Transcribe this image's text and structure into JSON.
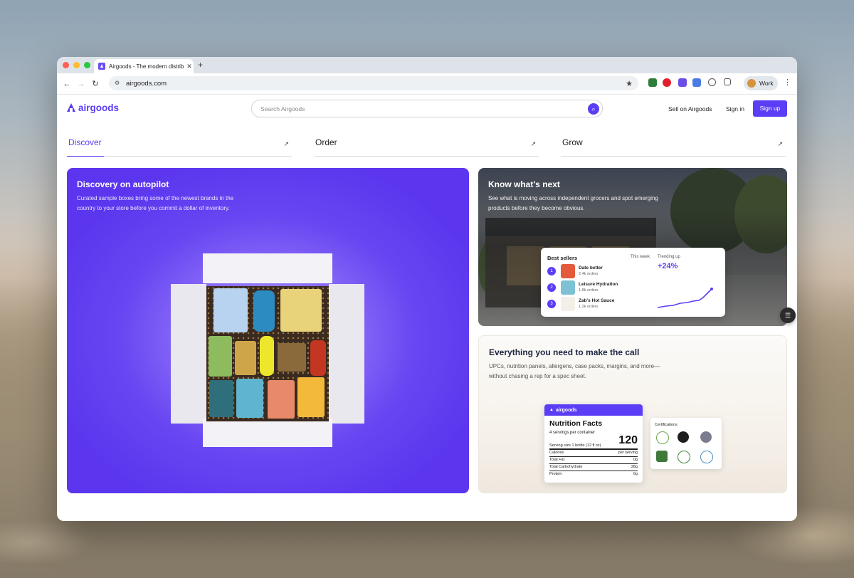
{
  "browser": {
    "tab_title": "Airgoods - The modern distrib",
    "url": "airgoods.com",
    "profile_label": "Work"
  },
  "site": {
    "logo_text": "airgoods",
    "search_placeholder": "Search Airgoods",
    "sell_link": "Sell on Airgoods",
    "signin_link": "Sign in",
    "signup_button": "Sign up",
    "nav_tabs": [
      {
        "label": "Discover",
        "active": true
      },
      {
        "label": "Order",
        "active": false
      },
      {
        "label": "Grow",
        "active": false
      }
    ]
  },
  "discover_card": {
    "title": "Discovery on autopilot",
    "desc_line1": "Curated sample boxes bring some of the newest brands in the",
    "desc_line2": "country to your store before you commit a dollar of inventory."
  },
  "trends_card": {
    "title": "Know what's next",
    "desc_line1": "See what is moving across independent grocers and spot emerging",
    "desc_line2": "products before they become obvious.",
    "widget": {
      "header": "Best sellers",
      "this_week": "This week",
      "trending_label": "Trending up",
      "trending_value": "+24%",
      "items": [
        {
          "rank": "1",
          "name": "Date better",
          "orders": "2.4k orders"
        },
        {
          "rank": "2",
          "name": "Leisure Hydration",
          "orders": "1.8k orders"
        },
        {
          "rank": "3",
          "name": "Zab's Hot Sauce",
          "orders": "1.2k orders"
        }
      ]
    }
  },
  "info_card": {
    "title": "Everything you need to make the call",
    "desc_line1": "UPCs, nutrition panels, allergens, case packs, margins, and more—",
    "desc_line2": "without chasing a rep for a spec sheet.",
    "nutrition": {
      "brand": "airgoods",
      "title": "Nutrition Facts",
      "servings": "4 servings per container",
      "calories_big": "120",
      "serving_size": "Serving size 1 bottle (12 fl oz)",
      "rows": [
        {
          "label": "Calories",
          "value": "per serving"
        },
        {
          "label": "Total Fat",
          "value": "0g"
        },
        {
          "label": "Total Carbohydrate",
          "value": "28g"
        },
        {
          "label": "Protein",
          "value": "0g"
        }
      ]
    },
    "certifications_label": "Certifications"
  },
  "colors": {
    "brand": "#5b3df5"
  }
}
